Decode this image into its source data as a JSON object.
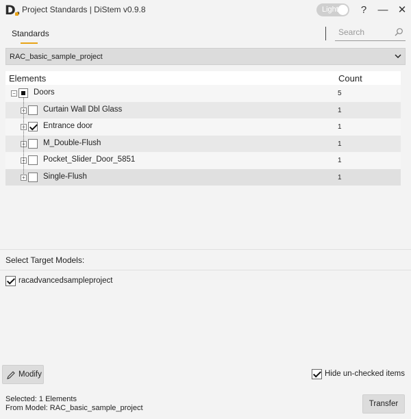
{
  "window": {
    "title": "Project Standards | DiStem v0.9.8",
    "logo_letter": "D.",
    "theme_toggle_label": "Light",
    "help_glyph": "?",
    "minimize_glyph": "—",
    "close_glyph": "✕"
  },
  "tabs": [
    {
      "label": "Standards",
      "active": true
    }
  ],
  "search": {
    "placeholder": "Search",
    "value": ""
  },
  "project_select": {
    "selected": "RAC_basic_sample_project"
  },
  "tree": {
    "headers": {
      "elements": "Elements",
      "count": "Count"
    },
    "root": {
      "label": "Doors",
      "count": "5",
      "state": "indeterminate"
    },
    "children": [
      {
        "label": "Curtain Wall Dbl Glass",
        "count": "1",
        "checked": false
      },
      {
        "label": "Entrance door",
        "count": "1",
        "checked": true
      },
      {
        "label": "M_Double-Flush",
        "count": "1",
        "checked": false
      },
      {
        "label": "Pocket_Slider_Door_5851",
        "count": "1",
        "checked": false
      },
      {
        "label": "Single-Flush",
        "count": "1",
        "checked": false
      }
    ]
  },
  "targets": {
    "label": "Select Target Models:",
    "items": [
      {
        "label": "racadvancedsampleproject",
        "checked": true
      }
    ]
  },
  "actions": {
    "modify_label": "Modify",
    "hide_unchecked_label": "Hide un-checked items",
    "hide_unchecked": true,
    "transfer_label": "Transfer"
  },
  "status": {
    "selected": "Selected: 1 Elements",
    "from_model": "From Model: RAC_basic_sample_project"
  },
  "colors": {
    "accent": "#e8a317",
    "background": "#f3f3f3"
  }
}
